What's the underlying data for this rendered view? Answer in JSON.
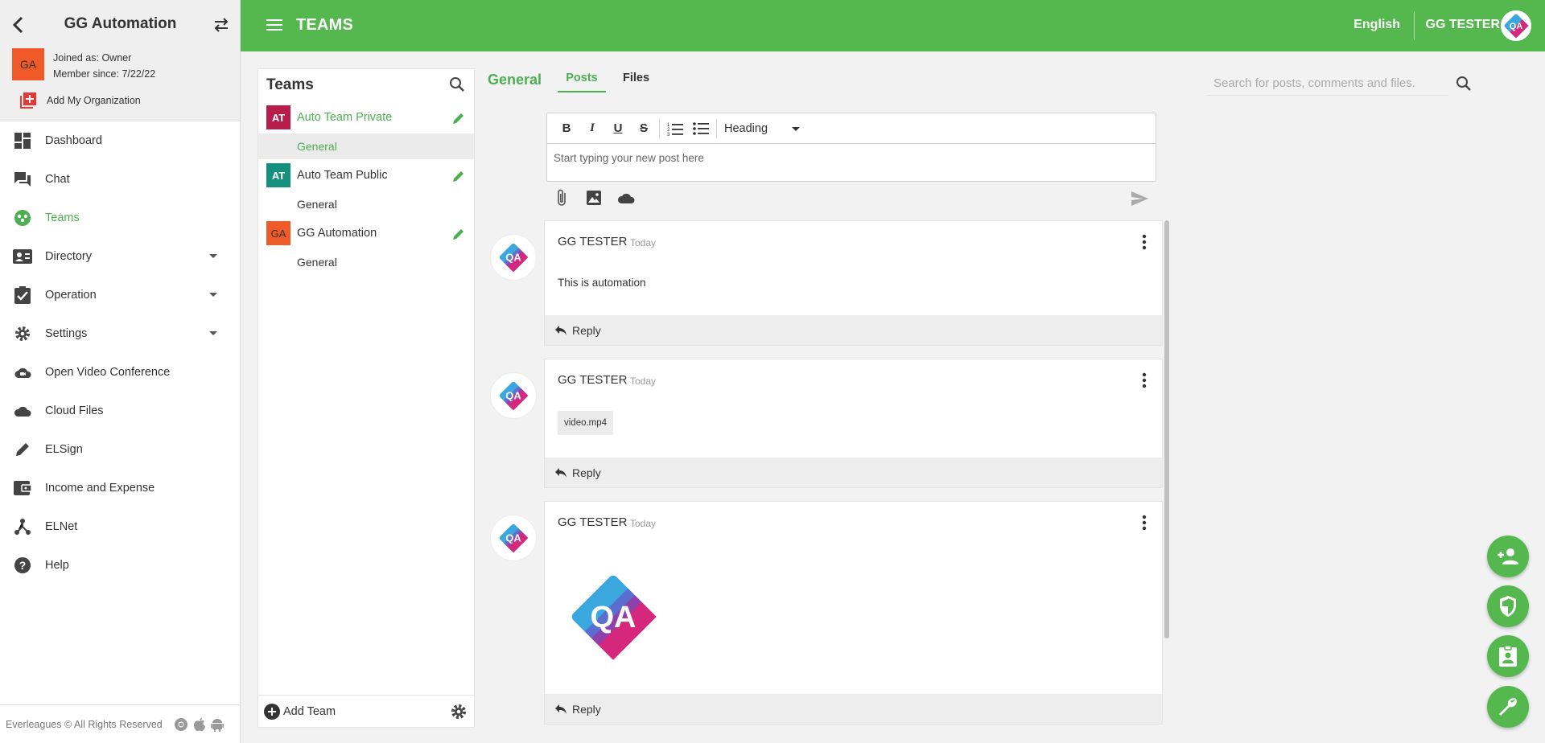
{
  "sidebar": {
    "org_name": "GG Automation",
    "avatar_initials": "GA",
    "joined_as": "Joined as: Owner",
    "member_since": "Member since: 7/22/22",
    "add_org": "Add My Organization",
    "items": [
      {
        "label": "Dashboard",
        "icon": "dashboard-icon"
      },
      {
        "label": "Chat",
        "icon": "chat-icon"
      },
      {
        "label": "Teams",
        "icon": "teams-icon",
        "active": true
      },
      {
        "label": "Directory",
        "icon": "directory-icon",
        "expandable": true
      },
      {
        "label": "Operation",
        "icon": "operation-icon",
        "expandable": true
      },
      {
        "label": "Settings",
        "icon": "settings-icon",
        "expandable": true
      },
      {
        "label": "Open Video Conference",
        "icon": "video-conference-icon"
      },
      {
        "label": "Cloud Files",
        "icon": "cloud-icon"
      },
      {
        "label": "ELSign",
        "icon": "pen-icon"
      },
      {
        "label": "Income and Expense",
        "icon": "wallet-icon"
      },
      {
        "label": "ELNet",
        "icon": "network-icon"
      },
      {
        "label": "Help",
        "icon": "help-icon"
      }
    ],
    "footer": "Everleagues © All Rights Reserved"
  },
  "topbar": {
    "title": "TEAMS",
    "language": "English",
    "user": "GG TESTER"
  },
  "teams_panel": {
    "title": "Teams",
    "teams": [
      {
        "initials": "AT",
        "name": "Auto Team Private",
        "color": "#b71c4a",
        "active": true,
        "channel": "General",
        "channel_active": true
      },
      {
        "initials": "AT",
        "name": "Auto Team Public",
        "color": "#13907e",
        "active": false,
        "channel": "General",
        "channel_active": false
      },
      {
        "initials": "GA",
        "name": "GG Automation",
        "color": "#f05a28",
        "active": false,
        "channel": "General",
        "channel_active": false
      }
    ],
    "add_team": "Add Team"
  },
  "channel": {
    "title": "General",
    "tabs": {
      "posts": "Posts",
      "files": "Files"
    },
    "search_placeholder": "Search for posts, comments and files."
  },
  "editor": {
    "heading": "Heading",
    "placeholder": "Start typing your new post here",
    "format_buttons": [
      "bold",
      "italic",
      "underline",
      "strikethrough",
      "ordered-list",
      "bullet-list"
    ]
  },
  "posts": [
    {
      "author": "GG TESTER",
      "time": "Today",
      "type": "text",
      "text": "This is automation",
      "reply": "Reply"
    },
    {
      "author": "GG TESTER",
      "time": "Today",
      "type": "file",
      "file": "video.mp4",
      "reply": "Reply"
    },
    {
      "author": "GG TESTER",
      "time": "Today",
      "type": "image",
      "reply": "Reply"
    }
  ],
  "colors": {
    "accent": "#55b84f",
    "active_text": "#4caf50"
  },
  "fabs": [
    "add-contact-icon",
    "shield-icon",
    "contact-badge-icon",
    "wrench-icon"
  ]
}
